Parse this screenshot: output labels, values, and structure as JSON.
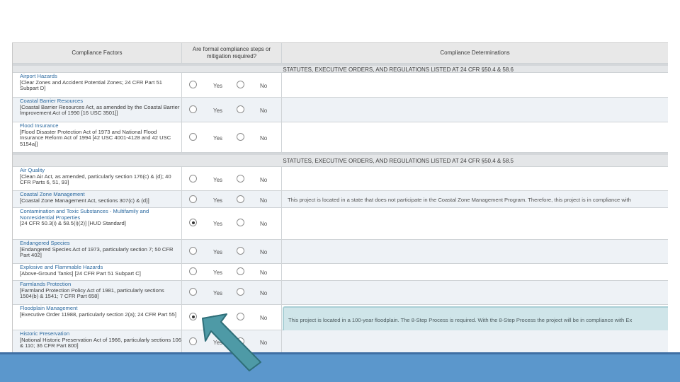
{
  "header": {
    "col1": "Compliance Factors",
    "col2": "Are formal compliance steps or mitigation required?",
    "col3": "Compliance Determinations"
  },
  "options": {
    "yes": "Yes",
    "no": "No"
  },
  "sections": [
    {
      "title": "STATUTES, EXECUTIVE ORDERS, AND REGULATIONS LISTED AT 24 CFR §50.4 & 58.6",
      "rows": [
        {
          "name": "Airport Hazards",
          "detail": "[Clear Zones and Accident Potential Zones; 24 CFR Part 51 Subpart D]",
          "selected": "none",
          "determination": ""
        },
        {
          "name": "Coastal Barrier Resources",
          "detail": "[Coastal Barrier Resources Act, as amended by the Coastal Barrier Improvement Act of 1990 [16 USC 3501]]",
          "selected": "none",
          "determination": ""
        },
        {
          "name": "Flood Insurance",
          "detail": "[Flood Disaster Protection Act of 1973 and National Flood Insurance Reform Act of 1994 [42 USC 4001-4128 and 42 USC 5154a]]",
          "selected": "none",
          "determination": ""
        }
      ]
    },
    {
      "title": "STATUTES, EXECUTIVE ORDERS, AND REGULATIONS LISTED AT 24 CFR §50.4 & 58.5",
      "rows": [
        {
          "name": "Air Quality",
          "detail": "[Clean Air Act, as amended, particularly section 176(c) & (d); 40 CFR Parts 6, 51, 93]",
          "selected": "none",
          "determination": ""
        },
        {
          "name": "Coastal Zone Management",
          "detail": "[Coastal Zone Management Act, sections 307(c) & (d)]",
          "selected": "none",
          "determination": "This project is located in a state that does not participate in the Coastal Zone Management Program. Therefore, this project is in compliance with"
        },
        {
          "name": "Contamination and Toxic Substances - Multifamily and Nonresidential Properties",
          "detail": "[24 CFR 50.3(i) & 58.5(i)(2)] [HUD Standard]",
          "selected": "yes",
          "determination": ""
        },
        {
          "name": "Endangered Species",
          "detail": "[Endangered Species Act of 1973, particularly section 7; 50 CFR Part 402]",
          "selected": "none",
          "determination": ""
        },
        {
          "name": "Explosive and Flammable Hazards",
          "detail": "[Above-Ground Tanks] [24 CFR Part 51 Subpart C]",
          "selected": "none",
          "determination": ""
        },
        {
          "name": "Farmlands Protection",
          "detail": "[Farmland Protection Policy Act of 1981, particularly sections 1504(b) & 1541; 7 CFR Part 658]",
          "selected": "none",
          "determination": ""
        },
        {
          "name": "Floodplain Management",
          "detail": "[Executive Order 11988, particularly section 2(a); 24 CFR Part 55]",
          "selected": "yes",
          "determination": "This project is located in a 100-year floodplain. The 8-Step Process is required. With the 8-Step Process the project will be in compliance with Ex"
        },
        {
          "name": "Historic Preservation",
          "detail": "[National Historic Preservation Act of 1966, particularly sections 106 & 110; 36 CFR Part 800]",
          "selected": "none",
          "determination": ""
        }
      ]
    }
  ],
  "colors": {
    "footer": "#5b97cc",
    "arrow": "#4e9aa6",
    "highlight": "#cfe5e9",
    "link": "#2c6aa0"
  }
}
